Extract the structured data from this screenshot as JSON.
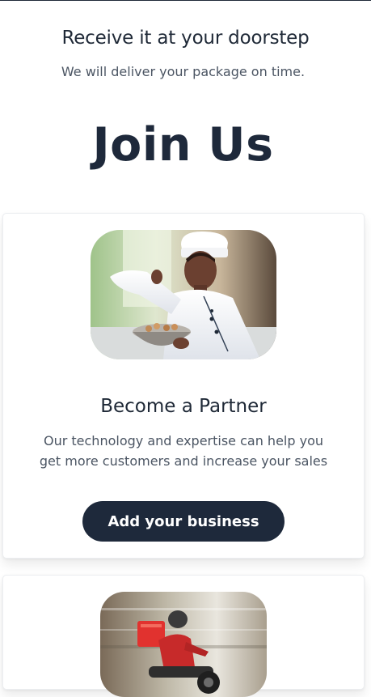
{
  "hero": {
    "title": "Receive it at your doorstep",
    "subtitle": "We will deliver your package on time."
  },
  "join": {
    "heading": "Join Us"
  },
  "partner_card": {
    "image": "chef-photo",
    "title": "Become a Partner",
    "description": "Our technology and expertise can help you get more customers and increase your sales",
    "button_label": "Add your business"
  },
  "rider_card": {
    "image": "delivery-rider-photo"
  },
  "colors": {
    "primary_dark": "#1e293b",
    "text_dark": "#1f2937",
    "text_muted": "#4b5563",
    "background": "#ffffff"
  }
}
